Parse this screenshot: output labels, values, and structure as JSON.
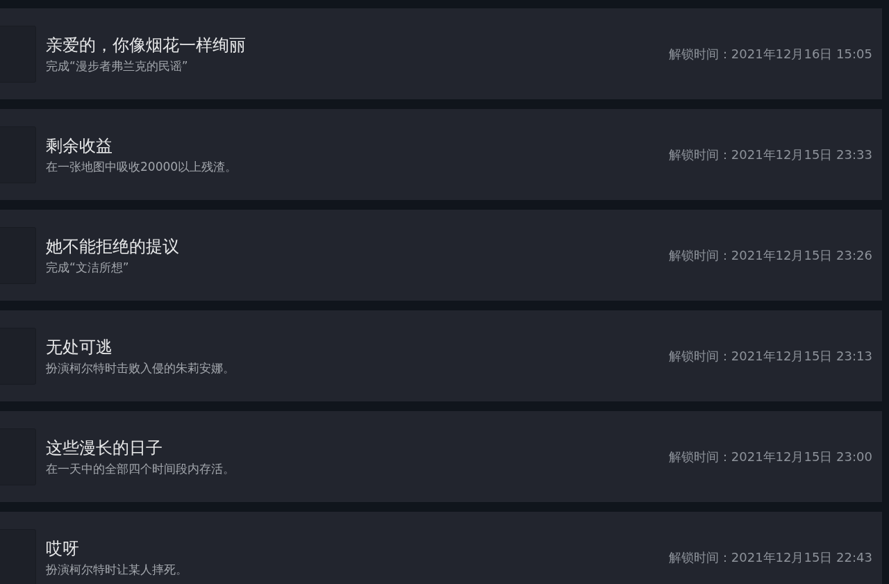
{
  "achievements": [
    {
      "title": "亲爱的，你像烟花一样绚丽",
      "description": "完成“漫步者弗兰克的民谣”",
      "unlock_time": "解锁时间：2021年12月16日 15:05"
    },
    {
      "title": "剩余收益",
      "description": "在一张地图中吸收20000以上残渣。",
      "unlock_time": "解锁时间：2021年12月15日 23:33"
    },
    {
      "title": "她不能拒绝的提议",
      "description": "完成“文洁所想”",
      "unlock_time": "解锁时间：2021年12月15日 23:26"
    },
    {
      "title": "无处可逃",
      "description": "扮演柯尔特时击败入侵的朱莉安娜。",
      "unlock_time": "解锁时间：2021年12月15日 23:13"
    },
    {
      "title": "这些漫长的日子",
      "description": "在一天中的全部四个时间段内存活。",
      "unlock_time": "解锁时间：2021年12月15日 23:00"
    },
    {
      "title": "哎呀",
      "description": "扮演柯尔特时让某人摔死。",
      "unlock_time": "解锁时间：2021年12月15日 22:43"
    }
  ]
}
